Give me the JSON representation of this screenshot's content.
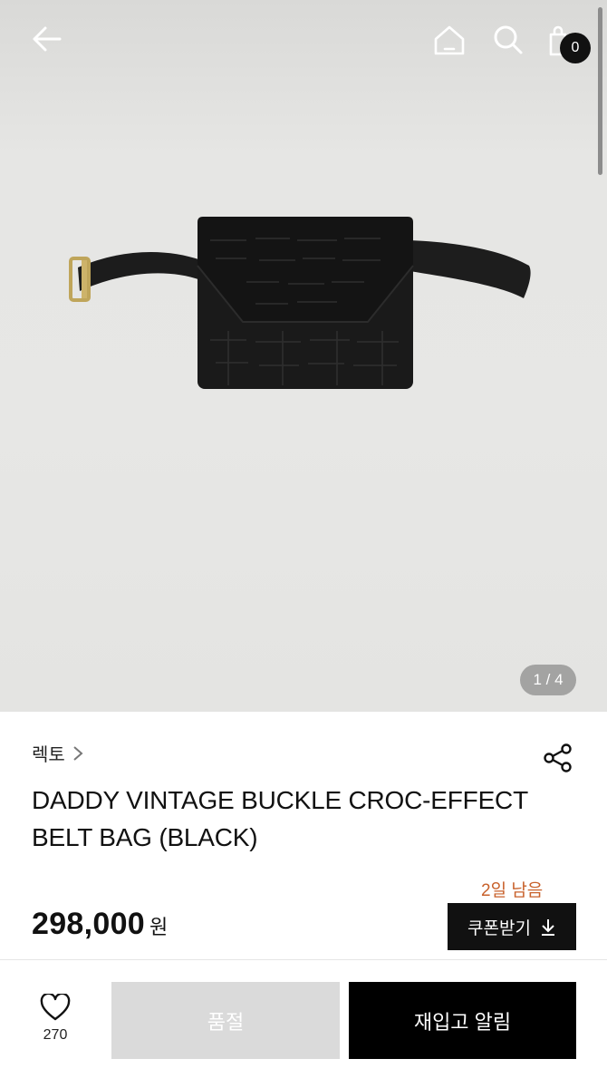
{
  "header": {
    "icons": [
      "back-arrow-icon",
      "home-icon",
      "search-icon",
      "shopping-bag-icon"
    ],
    "cart_count": "0"
  },
  "gallery": {
    "pager": "1 / 4",
    "image": "black croc-effect leather belt bag with gold buckle"
  },
  "product": {
    "brand": "렉토",
    "title": "DADDY VINTAGE BUCKLE CROC-EFFECT BELT BAG (BLACK)",
    "price": "298,000",
    "currency": "원",
    "remaining": "2일 남음",
    "coupon_label": "쿠폰받기"
  },
  "bottom_bar": {
    "like_count": "270",
    "soldout_label": "품절",
    "restock_label": "재입고 알림"
  },
  "colors": {
    "accent": "#c8612b",
    "primary": "#111111",
    "disabled": "#dadada"
  }
}
